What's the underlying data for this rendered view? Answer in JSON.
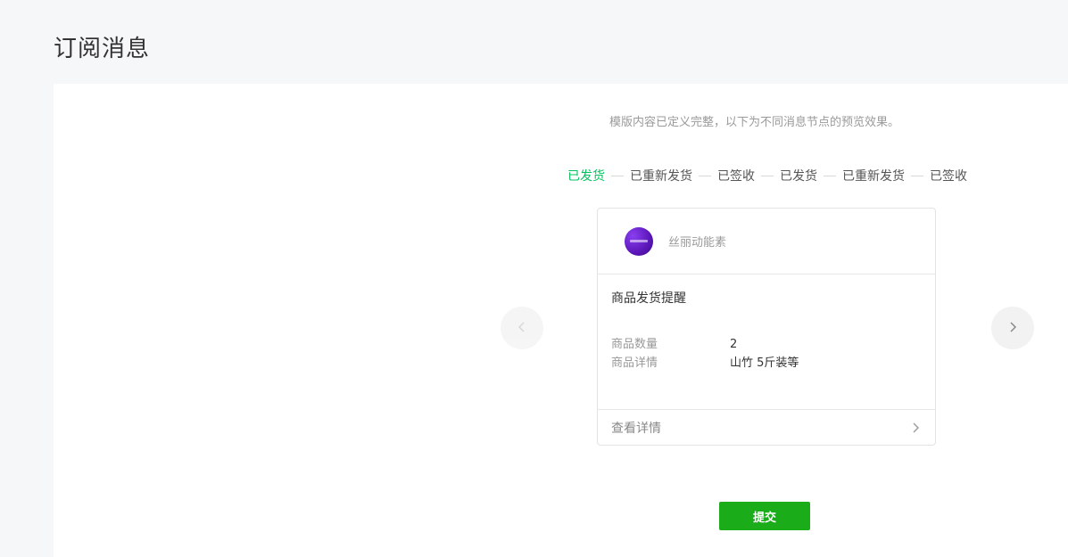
{
  "page": {
    "title": "订阅消息"
  },
  "preview": {
    "hint": "模版内容已定义完整，以下为不同消息节点的预览效果。",
    "steps": [
      {
        "label": "已发货",
        "active": true
      },
      {
        "label": "已重新发货",
        "active": false
      },
      {
        "label": "已签收",
        "active": false
      },
      {
        "label": "已发货",
        "active": false
      },
      {
        "label": "已重新发货",
        "active": false
      },
      {
        "label": "已签收",
        "active": false
      }
    ],
    "card": {
      "account_name": "丝丽动能素",
      "title": "商品发货提醒",
      "fields": [
        {
          "label": "商品数量",
          "value": "2"
        },
        {
          "label": "商品详情",
          "value": "山竹 5斤装等"
        }
      ],
      "footer_label": "查看详情"
    }
  },
  "actions": {
    "submit_label": "提交"
  },
  "colors": {
    "accent": "#07c160",
    "submit": "#1aad19"
  }
}
